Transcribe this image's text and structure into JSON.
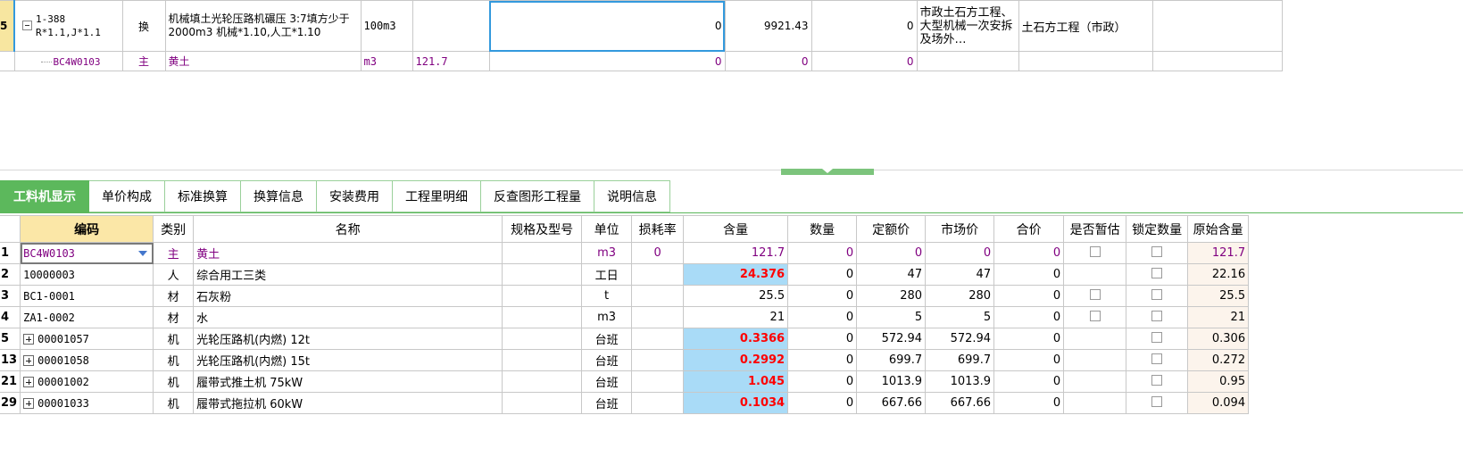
{
  "top_grid": {
    "row1": {
      "rownum": "5",
      "code_line1": "1-388",
      "code_line2": "R*1.1,J*1.1",
      "type": "换",
      "name": "机械填土光轮压路机碾压 3:7填方少于2000m3 机械*1.10,人工*1.10",
      "unit": "100m3",
      "qty": "",
      "v1": "0",
      "v2": "9921.43",
      "v3": "0",
      "note": "市政土石方工程、大型机械一次安拆及场外…",
      "category": "土石方工程（市政）"
    },
    "row2": {
      "code": "BC4W0103",
      "type": "主",
      "name": "黄土",
      "unit": "m3",
      "qty": "121.7",
      "v1": "0",
      "v2": "0",
      "v3": "0"
    }
  },
  "tabs": [
    {
      "label": "工料机显示",
      "active": true
    },
    {
      "label": "单价构成"
    },
    {
      "label": "标准换算"
    },
    {
      "label": "换算信息"
    },
    {
      "label": "安装费用"
    },
    {
      "label": "工程里明细"
    },
    {
      "label": "反查图形工程量"
    },
    {
      "label": "说明信息"
    }
  ],
  "columns": [
    "编码",
    "类别",
    "名称",
    "规格及型号",
    "单位",
    "损耗率",
    "含量",
    "数量",
    "定额价",
    "市场价",
    "合价",
    "是否暂估",
    "锁定数量",
    "原始含量"
  ],
  "rows": [
    {
      "rn": "1",
      "code": "BC4W0103",
      "type": "主",
      "name": "黄土",
      "spec": "",
      "unit": "m3",
      "loss": "0",
      "content": "121.7",
      "qty": "0",
      "base_price": "0",
      "market_price": "0",
      "total": "0",
      "estimated_cb": true,
      "locked_cb": true,
      "orig": "121.7",
      "purple": true
    },
    {
      "rn": "2",
      "code": "10000003",
      "type": "人",
      "name": "综合用工三类",
      "spec": "",
      "unit": "工日",
      "loss": "",
      "content": "24.376",
      "qty": "0",
      "base_price": "47",
      "market_price": "47",
      "total": "0",
      "estimated_cb": false,
      "locked_cb": true,
      "orig": "22.16",
      "hl": true
    },
    {
      "rn": "3",
      "code": "BC1-0001",
      "type": "材",
      "name": "石灰粉",
      "spec": "",
      "unit": "t",
      "loss": "",
      "content": "25.5",
      "qty": "0",
      "base_price": "280",
      "market_price": "280",
      "total": "0",
      "estimated_cb": true,
      "locked_cb": true,
      "orig": "25.5"
    },
    {
      "rn": "4",
      "code": "ZA1-0002",
      "type": "材",
      "name": "水",
      "spec": "",
      "unit": "m3",
      "loss": "",
      "content": "21",
      "qty": "0",
      "base_price": "5",
      "market_price": "5",
      "total": "0",
      "estimated_cb": true,
      "locked_cb": true,
      "orig": "21"
    },
    {
      "rn": "5",
      "code": "00001057",
      "type": "机",
      "name": "光轮压路机(内燃) 12t",
      "spec": "",
      "unit": "台班",
      "loss": "",
      "content": "0.3366",
      "qty": "0",
      "base_price": "572.94",
      "market_price": "572.94",
      "total": "0",
      "estimated_cb": false,
      "locked_cb": true,
      "orig": "0.306",
      "hl": true,
      "expand": true
    },
    {
      "rn": "13",
      "code": "00001058",
      "type": "机",
      "name": "光轮压路机(内燃) 15t",
      "spec": "",
      "unit": "台班",
      "loss": "",
      "content": "0.2992",
      "qty": "0",
      "base_price": "699.7",
      "market_price": "699.7",
      "total": "0",
      "estimated_cb": false,
      "locked_cb": true,
      "orig": "0.272",
      "hl": true,
      "expand": true
    },
    {
      "rn": "21",
      "code": "00001002",
      "type": "机",
      "name": "履带式推土机 75kW",
      "spec": "",
      "unit": "台班",
      "loss": "",
      "content": "1.045",
      "qty": "0",
      "base_price": "1013.9",
      "market_price": "1013.9",
      "total": "0",
      "estimated_cb": false,
      "locked_cb": true,
      "orig": "0.95",
      "hl": true,
      "expand": true
    },
    {
      "rn": "29",
      "code": "00001033",
      "type": "机",
      "name": "履带式拖拉机 60kW",
      "spec": "",
      "unit": "台班",
      "loss": "",
      "content": "0.1034",
      "qty": "0",
      "base_price": "667.66",
      "market_price": "667.66",
      "total": "0",
      "estimated_cb": false,
      "locked_cb": true,
      "orig": "0.094",
      "hl": true,
      "expand": true
    }
  ],
  "colors": {
    "tab_active": "#5cb85c",
    "highlight_cell": "#a9dbf7",
    "highlight_text": "#ff0000",
    "main_material_text": "#800080",
    "sorted_header": "#fbe7a7",
    "selected_row_number": "#f7e6a0"
  }
}
